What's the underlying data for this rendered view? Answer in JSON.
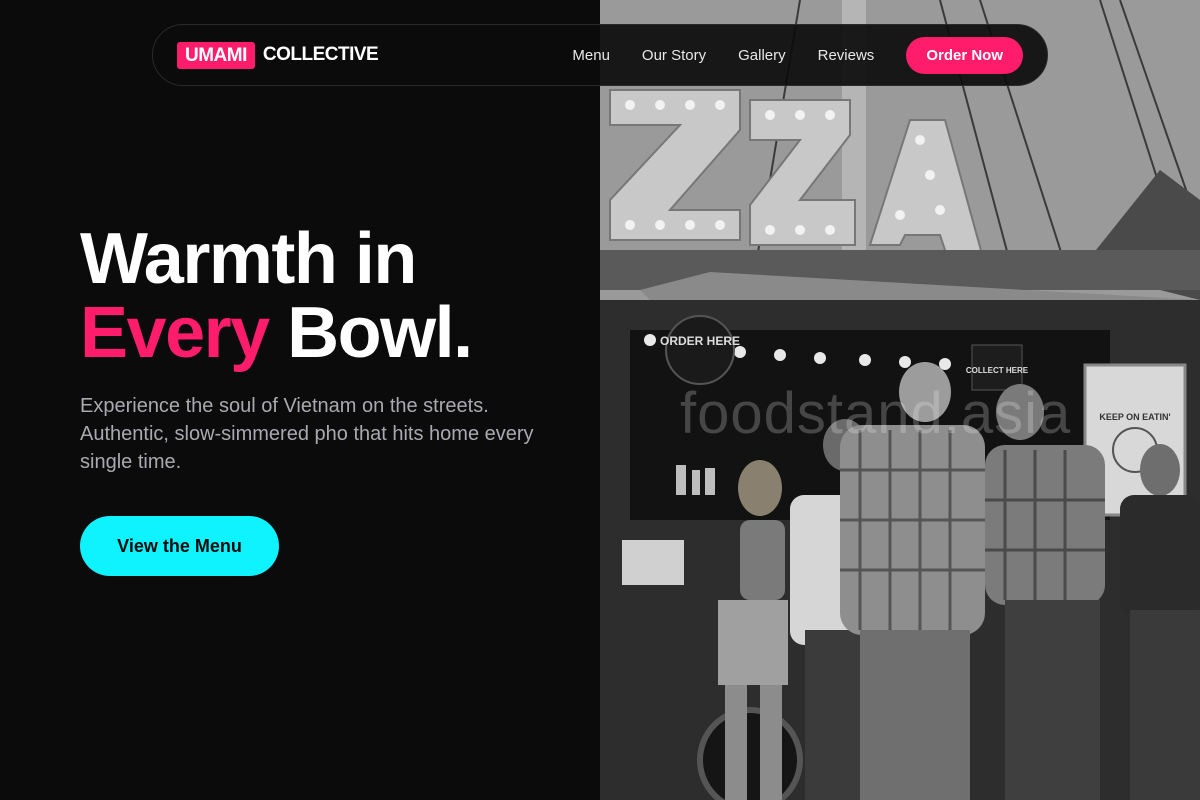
{
  "brand": {
    "badge": "UMAMI",
    "name": "COLLECTIVE",
    "accent_color": "#ff1d6b"
  },
  "nav": {
    "links": [
      "Menu",
      "Our Story",
      "Gallery",
      "Reviews"
    ],
    "cta": "Order Now"
  },
  "hero": {
    "title_line1": "Warmth in",
    "title_accent": "Every",
    "title_rest": " Bowl.",
    "subtitle": "Experience the soul of Vietnam on the streets. Authentic, slow-simmered pho that hits home every single time.",
    "cta_label": "View the Menu",
    "cta_color": "#0ff2ff"
  },
  "photo": {
    "watermark": "foodstand.asia",
    "sign_order": "ORDER HERE",
    "sign_collect": "COLLECT HERE",
    "sign_poster": "KEEP ON EATIN'"
  }
}
